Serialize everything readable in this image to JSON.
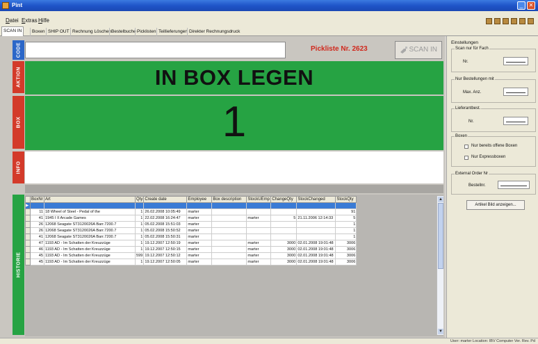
{
  "window": {
    "title": "Pint"
  },
  "menu": [
    {
      "label": "Datei"
    },
    {
      "label": "Extras"
    },
    {
      "label": "Hilfe"
    }
  ],
  "tabs": [
    {
      "label": "SCAN IN",
      "active": true
    },
    {
      "label": "Boxen"
    },
    {
      "label": "SHIP OUT"
    },
    {
      "label": "Rechnung Löschen"
    },
    {
      "label": "Bestelbuche"
    },
    {
      "label": "Picklisten"
    },
    {
      "label": "Teillieferungen"
    },
    {
      "label": "Direkter Rechnungsdruck"
    }
  ],
  "sidebar": {
    "code": "CODE",
    "aktion": "AKTION",
    "box": "BOX",
    "info": "INFO",
    "historie": "HISTORIE"
  },
  "scan": {
    "pickliste": "Pickliste Nr. 2623",
    "button": "SCAN IN"
  },
  "aktion_text": "IN BOX LEGEN",
  "box_number": "1",
  "history": {
    "columns": [
      "BoxNr",
      "Art",
      "Qty",
      "Create date",
      "Employee",
      "Box description",
      "StockUEmp",
      "ChangeQty",
      "StockChanged",
      "StockQty"
    ],
    "rows": [
      {
        "box": "",
        "art": "",
        "qty": "",
        "date": "",
        "emp": "",
        "desc": "",
        "stockemp": "",
        "change": "",
        "changed": "",
        "stockqty": "",
        "selected": true
      },
      {
        "box": "11",
        "art": "18 Wheel of Steel - Pedal of the",
        "qty": "1",
        "date": "26.02.2008 10:05:49",
        "emp": "marter",
        "desc": "",
        "stockemp": "",
        "change": "",
        "changed": "",
        "stockqty": "91"
      },
      {
        "box": "41",
        "art": "1945 I II Arcade Games",
        "qty": "1",
        "date": "22.02.2008 16:24:47",
        "emp": "marter",
        "desc": "",
        "stockemp": "marter",
        "change": "5",
        "changed": "21.11.2006 12:14:33",
        "stockqty": "5"
      },
      {
        "box": "26",
        "art": "12068 Seagate ST3120026A Barr.7200.7",
        "qty": "1",
        "date": "05.02.2008 15:51:03",
        "emp": "marter",
        "desc": "",
        "stockemp": "",
        "change": "",
        "changed": "",
        "stockqty": "1"
      },
      {
        "box": "26",
        "art": "12068 Seagate ST3120026A Barr.7200.7",
        "qty": "1",
        "date": "05.02.2008 15:50:52",
        "emp": "marter",
        "desc": "",
        "stockemp": "",
        "change": "",
        "changed": "",
        "stockqty": "1"
      },
      {
        "box": "41",
        "art": "12068 Seagate ST3120026A Barr.7200.7",
        "qty": "1",
        "date": "05.02.2008 15:50:31",
        "emp": "marter",
        "desc": "",
        "stockemp": "",
        "change": "",
        "changed": "",
        "stockqty": "1"
      },
      {
        "box": "47",
        "art": "1193 AD - Im Schatten der Kreuzzüge",
        "qty": "1",
        "date": "19.12.2007 12:50:19",
        "emp": "marter",
        "desc": "",
        "stockemp": "marter",
        "change": "3000",
        "changed": "02.01.2008 19:01:48",
        "stockqty": "3006"
      },
      {
        "box": "46",
        "art": "1193 AD - Im Schatten der Kreuzzüge",
        "qty": "1",
        "date": "19.12.2007 12:50:15",
        "emp": "marter",
        "desc": "",
        "stockemp": "marter",
        "change": "3000",
        "changed": "02.01.2008 19:01:48",
        "stockqty": "3006"
      },
      {
        "box": "45",
        "art": "1193 AD - Im Schatten der Kreuzzüge",
        "qty": "599",
        "date": "19.12.2007 12:50:12",
        "emp": "marter",
        "desc": "",
        "stockemp": "marter",
        "change": "3000",
        "changed": "02.01.2008 19:01:48",
        "stockqty": "3006"
      },
      {
        "box": "45",
        "art": "1193 AD - Im Schatten der Kreuzzüge",
        "qty": "1",
        "date": "19.12.2007 12:50:05",
        "emp": "marter",
        "desc": "",
        "stockemp": "marter",
        "change": "3000",
        "changed": "02.01.2008 19:01:48",
        "stockqty": "3006"
      }
    ]
  },
  "settings": {
    "title": "Einstellungen",
    "scan_fach": {
      "legend": "Scan nur für Fach",
      "label": "Nr."
    },
    "bestellungen": {
      "legend": "Nur Bestellungen mit",
      "label": "Max. Anz."
    },
    "lieferant": {
      "legend": "Lieferantbest.",
      "label": "Nr."
    },
    "boxen": {
      "legend": "Boxen",
      "opt1": "Nur bereits offene Boxen",
      "opt2": "Nur Expressboxen"
    },
    "external": {
      "legend": "External Order Nr",
      "label": "Bestellnr."
    },
    "picture_button": "Artikel Bild anzeigen..."
  },
  "status": "User: marter Location: IBV Computer Ver. Rev. Pd"
}
